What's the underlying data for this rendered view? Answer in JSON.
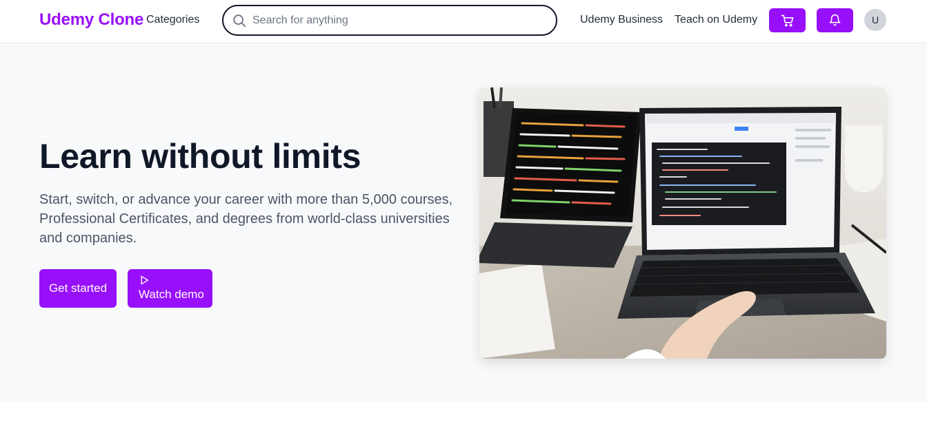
{
  "header": {
    "logo": "Udemy Clone",
    "categories_label": "Categories",
    "search": {
      "placeholder": "Search for anything",
      "value": "",
      "icon": "search-icon"
    },
    "nav_links": [
      "Udemy Business",
      "Teach on Udemy"
    ],
    "cart_icon": "shopping-cart-icon",
    "notifications_icon": "bell-icon",
    "avatar_initial": "U"
  },
  "hero": {
    "title": "Learn without limits",
    "subtitle": "Start, switch, or advance your career with more than 5,000 courses, Professional Certificates, and degrees from world-class universities and companies.",
    "primary_button": "Get started",
    "secondary_button": "Watch demo",
    "secondary_button_icon": "play-icon",
    "image_subject": "laptop-and-tablet-with-code"
  },
  "colors": {
    "brand": "#9810fa",
    "hero_background": "#f8f9fb",
    "heading": "#101828",
    "body_text": "#4a5565"
  }
}
